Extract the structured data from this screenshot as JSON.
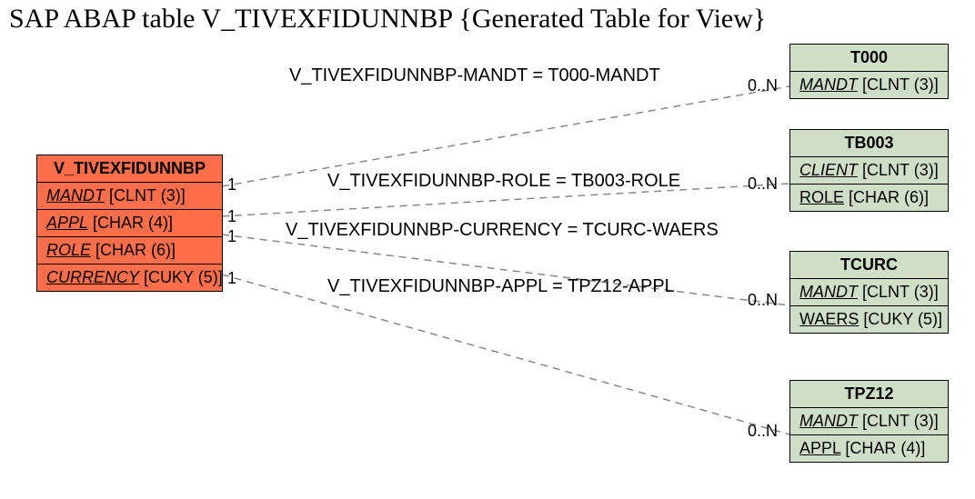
{
  "title": "SAP ABAP table V_TIVEXFIDUNNBP {Generated Table for View}",
  "source": {
    "name": "V_TIVEXFIDUNNBP",
    "rows": [
      {
        "field": "MANDT",
        "type": "[CLNT (3)]"
      },
      {
        "field": "APPL",
        "type": "[CHAR (4)]"
      },
      {
        "field": "ROLE",
        "type": "[CHAR (6)]"
      },
      {
        "field": "CURRENCY",
        "type": "[CUKY (5)]"
      }
    ]
  },
  "targets": [
    {
      "name": "T000",
      "rows": [
        {
          "field": "MANDT",
          "type": "[CLNT (3)]",
          "ital": true
        }
      ]
    },
    {
      "name": "TB003",
      "rows": [
        {
          "field": "CLIENT",
          "type": "[CLNT (3)]",
          "ital": true
        },
        {
          "field": "ROLE",
          "type": "[CHAR (6)]"
        }
      ]
    },
    {
      "name": "TCURC",
      "rows": [
        {
          "field": "MANDT",
          "type": "[CLNT (3)]",
          "ital": true
        },
        {
          "field": "WAERS",
          "type": "[CUKY (5)]"
        }
      ]
    },
    {
      "name": "TPZ12",
      "rows": [
        {
          "field": "MANDT",
          "type": "[CLNT (3)]",
          "ital": true
        },
        {
          "field": "APPL",
          "type": "[CHAR (4)]"
        }
      ]
    }
  ],
  "relations": [
    {
      "label": "V_TIVEXFIDUNNBP-MANDT = T000-MANDT",
      "srcCard": "1",
      "tgtCard": "0..N"
    },
    {
      "label": "V_TIVEXFIDUNNBP-ROLE = TB003-ROLE",
      "srcCard": "1",
      "tgtCard": "0..N"
    },
    {
      "label": "V_TIVEXFIDUNNBP-CURRENCY = TCURC-WAERS",
      "srcCard": "1",
      "tgtCard": "0..N"
    },
    {
      "label": "V_TIVEXFIDUNNBP-APPL = TPZ12-APPL",
      "srcCard": "1",
      "tgtCard": "0..N"
    }
  ]
}
